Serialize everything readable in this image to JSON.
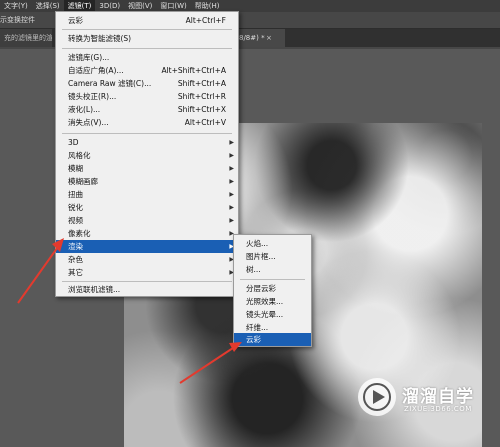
{
  "menubar": {
    "items": [
      "文字(Y)",
      "选择(S)",
      "滤镜(T)",
      "3D(D)",
      "视图(V)",
      "窗口(W)",
      "帮助(H)"
    ]
  },
  "optbar": {
    "label": "示变换控件"
  },
  "tabs": {
    "left": "充的滤镜里的渲染",
    "right": "8/8#) *",
    "close": "×"
  },
  "filter_menu": {
    "items": [
      {
        "label": "云彩",
        "shortcut": "Alt+Ctrl+F"
      },
      {
        "label": "转换为智能滤镜(S)"
      },
      {
        "label": "滤镜库(G)..."
      },
      {
        "label": "自适应广角(A)...",
        "shortcut": "Alt+Shift+Ctrl+A"
      },
      {
        "label": "Camera Raw 滤镜(C)...",
        "shortcut": "Shift+Ctrl+A"
      },
      {
        "label": "镜头校正(R)...",
        "shortcut": "Shift+Ctrl+R"
      },
      {
        "label": "液化(L)...",
        "shortcut": "Shift+Ctrl+X"
      },
      {
        "label": "消失点(V)...",
        "shortcut": "Alt+Ctrl+V"
      },
      {
        "label": "3D"
      },
      {
        "label": "风格化"
      },
      {
        "label": "模糊"
      },
      {
        "label": "模糊画廊"
      },
      {
        "label": "扭曲"
      },
      {
        "label": "锐化"
      },
      {
        "label": "视频"
      },
      {
        "label": "像素化"
      },
      {
        "label": "渲染"
      },
      {
        "label": "杂色"
      },
      {
        "label": "其它"
      },
      {
        "label": "浏览联机滤镜..."
      }
    ]
  },
  "render_submenu": {
    "items": [
      "火焰...",
      "图片框...",
      "树...",
      "分层云彩",
      "光照效果...",
      "镜头光晕...",
      "纤维...",
      "云彩"
    ]
  },
  "watermark": {
    "title": "溜溜自学",
    "subtitle": "ZIXUE.3D66.COM"
  },
  "colors": {
    "highlight": "#1a5fb4",
    "annotation_arrow": "#e33a2e"
  }
}
